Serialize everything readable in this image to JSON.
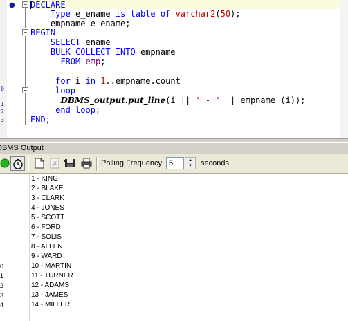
{
  "editor": {
    "lines": [
      [
        {
          "t": "DECLARE",
          "c": "kw"
        }
      ],
      [
        {
          "t": "    "
        },
        {
          "t": "Type",
          "c": "kw"
        },
        {
          "t": " e_ename "
        },
        {
          "t": "is table of",
          "c": "kw"
        },
        {
          "t": " "
        },
        {
          "t": "varchar2",
          "c": "str"
        },
        {
          "t": "("
        },
        {
          "t": "50",
          "c": "num"
        },
        {
          "t": ");"
        }
      ],
      [
        {
          "t": "    empname e_ename;"
        }
      ],
      [
        {
          "t": "BEGIN",
          "c": "kw"
        }
      ],
      [
        {
          "t": "    "
        },
        {
          "t": "SELECT",
          "c": "kw"
        },
        {
          "t": " ename"
        }
      ],
      [
        {
          "t": "    "
        },
        {
          "t": "BULK COLLECT INTO",
          "c": "kw"
        },
        {
          "t": " empname"
        }
      ],
      [
        {
          "t": "      "
        },
        {
          "t": "FROM",
          "c": "kw"
        },
        {
          "t": " "
        },
        {
          "t": "emp",
          "c": "tbl"
        },
        {
          "t": ";"
        }
      ],
      [
        {
          "t": ""
        }
      ],
      [
        {
          "t": "     "
        },
        {
          "t": "for",
          "c": "kw"
        },
        {
          "t": " i "
        },
        {
          "t": "in",
          "c": "kw"
        },
        {
          "t": " "
        },
        {
          "t": "1",
          "c": "num"
        },
        {
          "t": "..empname.count"
        }
      ],
      [
        {
          "t": "     "
        },
        {
          "t": "loop",
          "c": "kw"
        }
      ],
      [
        {
          "t": "      "
        },
        {
          "t": "DBMS_output.put_line",
          "c": "pkg"
        },
        {
          "t": "(i || "
        },
        {
          "t": "' - '",
          "c": "str"
        },
        {
          "t": " || empname (i));"
        }
      ],
      [
        {
          "t": "     "
        },
        {
          "t": "end loop;",
          "c": "kw"
        }
      ],
      [
        {
          "t": "END;",
          "c": "kw"
        }
      ]
    ],
    "gutter_numbers": [
      "0",
      "1",
      "2",
      "3"
    ]
  },
  "panel": {
    "title": "DBMS Output"
  },
  "toolbar": {
    "polling_label": "Polling Frequency:",
    "polling_value": "5",
    "seconds_label": "seconds"
  },
  "output": {
    "lines": [
      "1 - KING",
      "2 - BLAKE",
      "3 - CLARK",
      "4 - JONES",
      "5 - SCOTT",
      "6 - FORD",
      "7 - SOLIS",
      "8 - ALLEN",
      "9 - WARD",
      "10 - MARTIN",
      "11 - TURNER",
      "12 - ADAMS",
      "13 - JAMES",
      "14 - MILLER"
    ],
    "gutter_numbers": [
      "0",
      "1",
      "2",
      "3",
      "4"
    ]
  },
  "colors": {
    "keyword": "#0000ff",
    "string": "#c00000",
    "table": "#800080"
  }
}
